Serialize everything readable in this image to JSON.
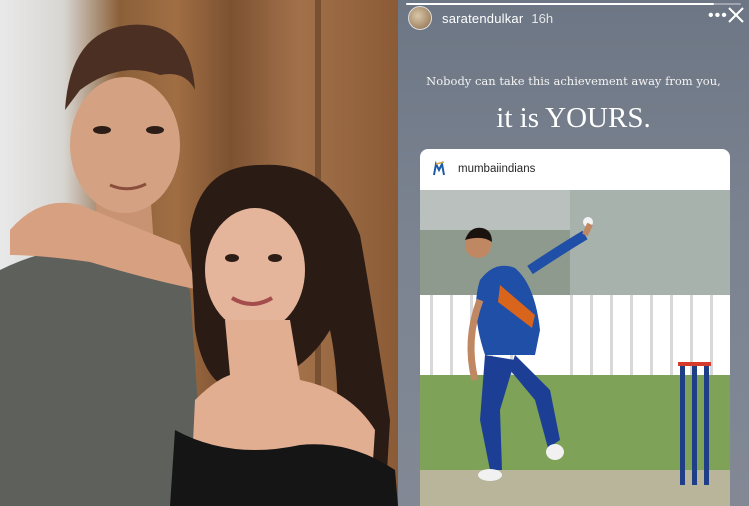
{
  "story": {
    "username": "saratendulkar",
    "time": "16h",
    "progress": 0.92,
    "caption_line1": "Nobody can take this achievement away from you,",
    "caption_line2": "it is YOURS.",
    "menu_icon": "more-horizontal-icon",
    "close_icon": "close-icon"
  },
  "shared_post": {
    "username": "mumbaiindians",
    "logo_text": "M",
    "logo_color": "#1d5aa8"
  },
  "colors": {
    "story_bg": "#78808d",
    "jersey_blue": "#1f4fa6"
  }
}
